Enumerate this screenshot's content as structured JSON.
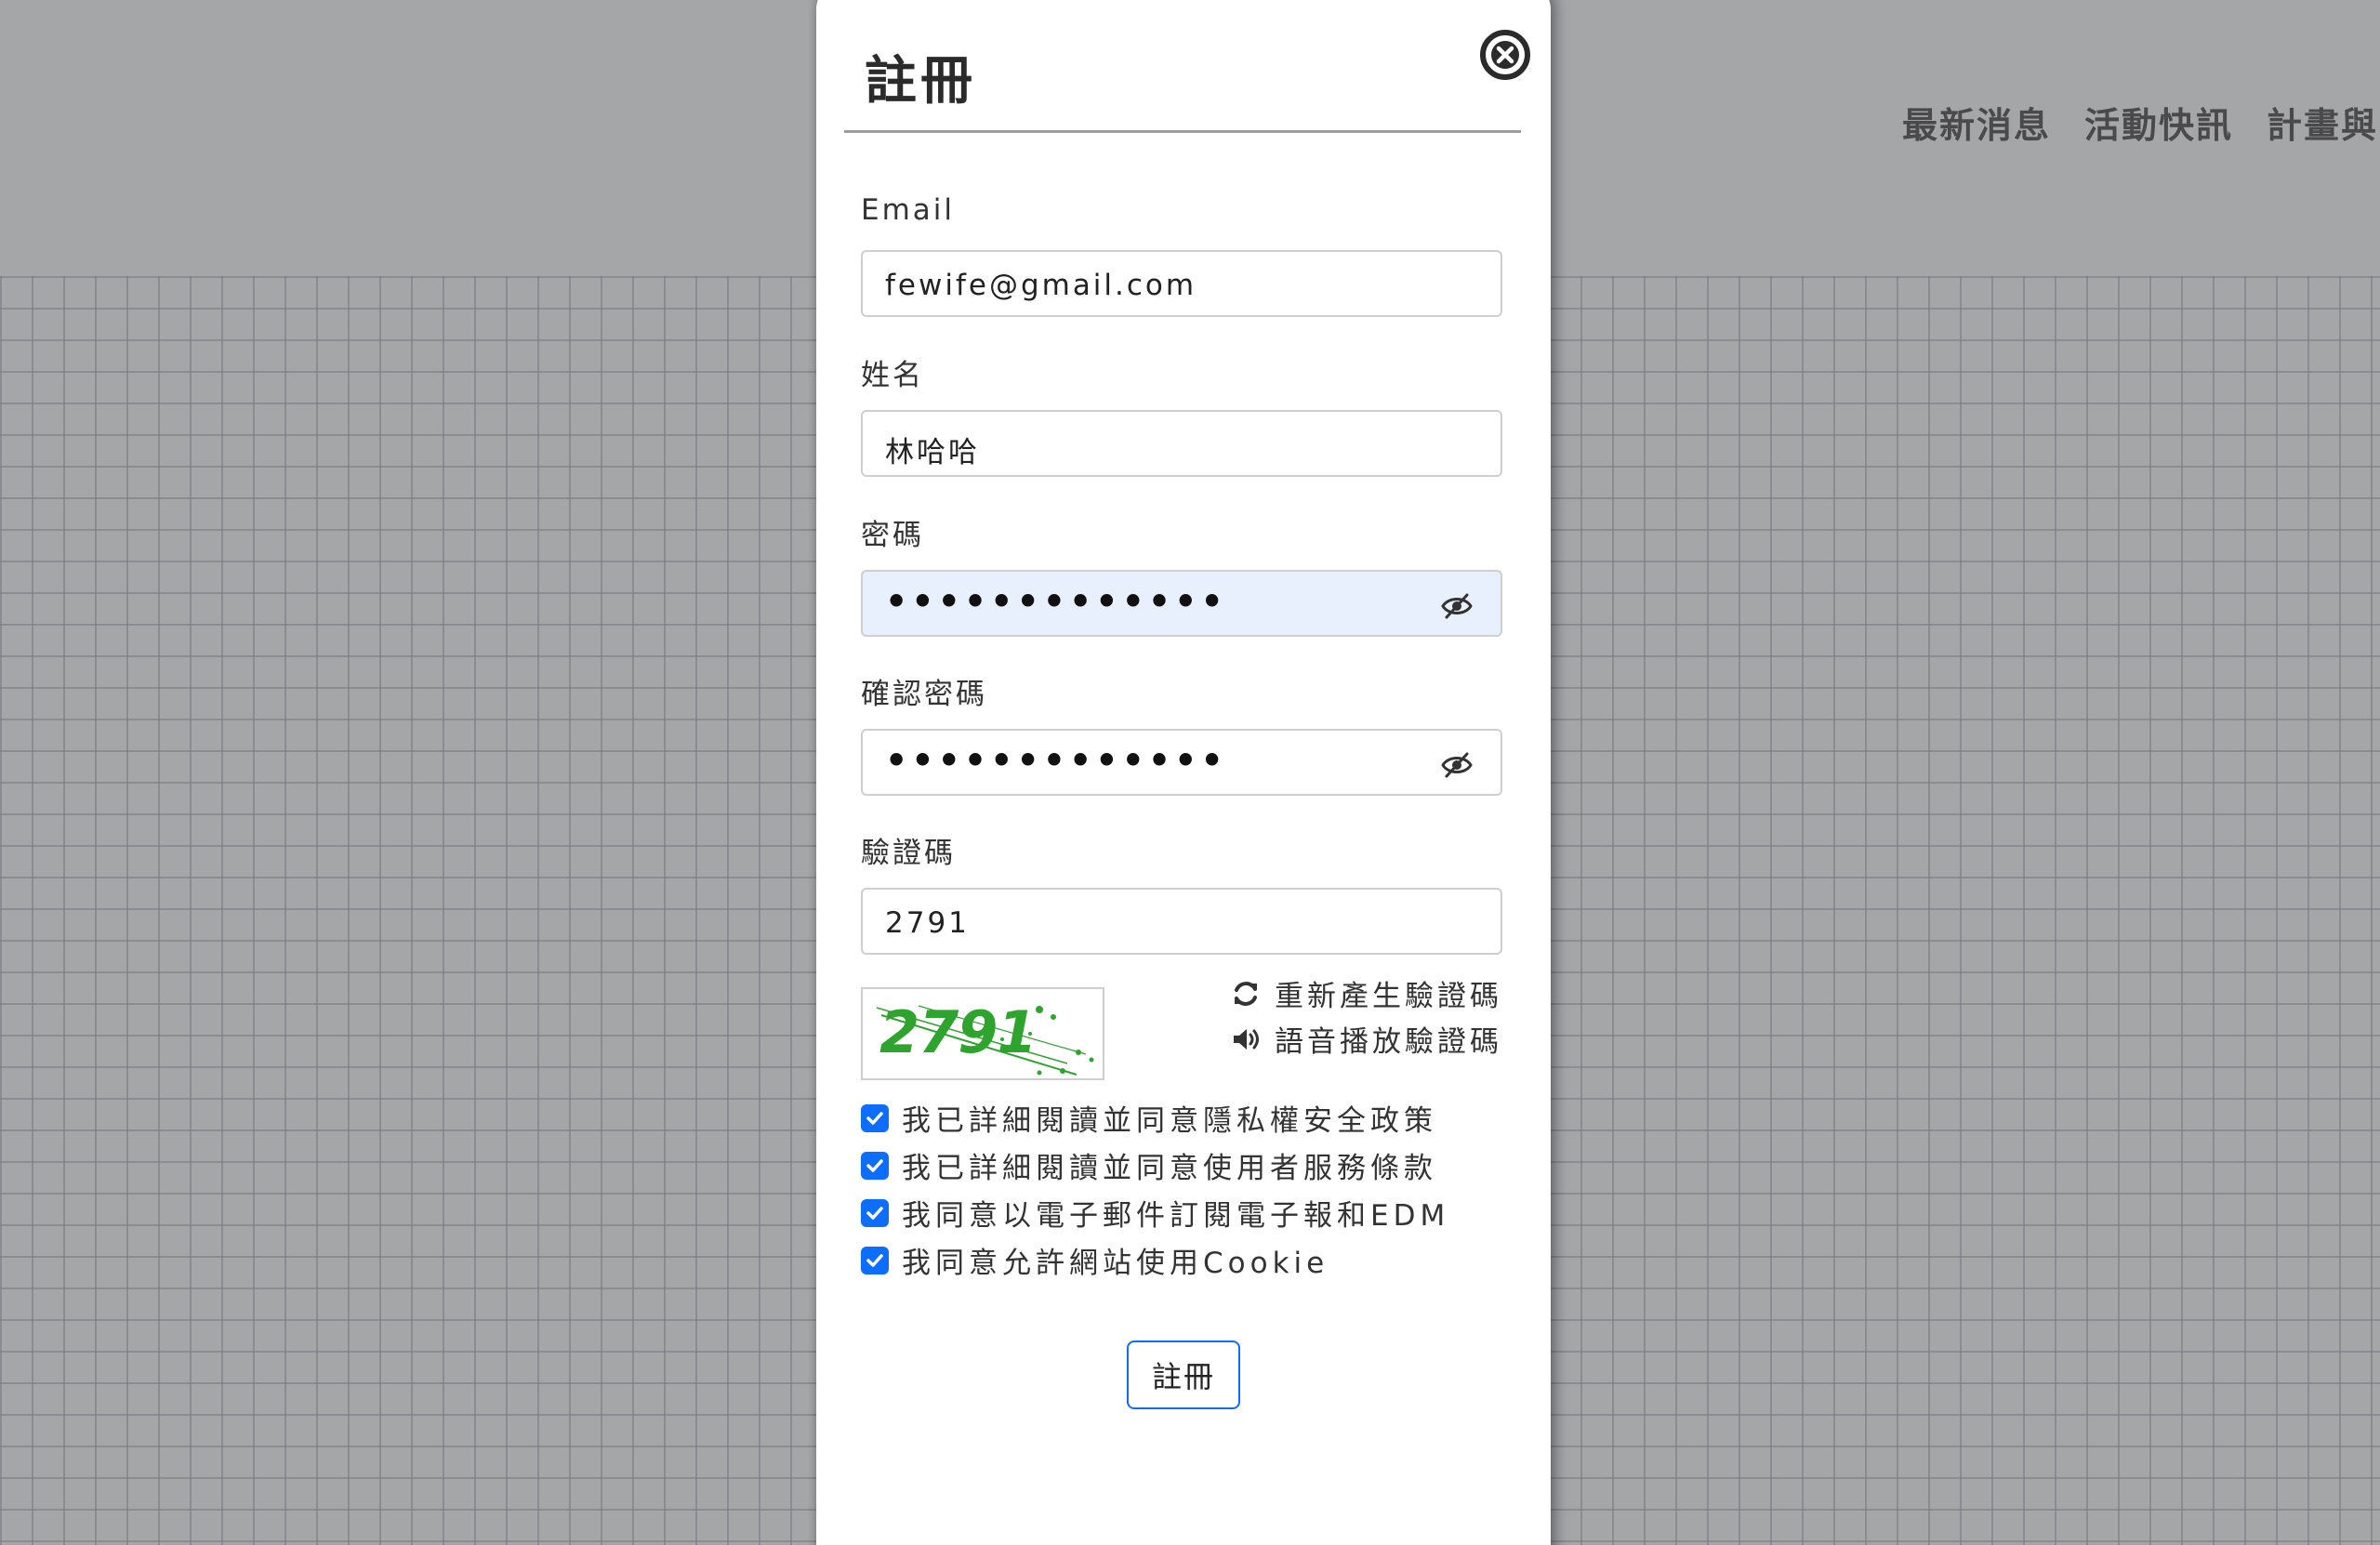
{
  "nav": {
    "items": [
      "最新消息",
      "活動快訊",
      "計畫與"
    ]
  },
  "modal": {
    "title": "註冊",
    "close_icon": "close-circle-icon",
    "fields": {
      "email": {
        "label": "Email",
        "value": "fewife@gmail.com"
      },
      "name": {
        "label": "姓名",
        "value": "林哈哈"
      },
      "password": {
        "label": "密碼",
        "value": "•••••••••••••"
      },
      "confirm_password": {
        "label": "確認密碼",
        "value": "•••••••••••••"
      },
      "captcha_input": {
        "label": "驗證碼",
        "value": "2791"
      }
    },
    "captcha": {
      "image_text": "2791",
      "refresh_label": "重新產生驗證碼",
      "refresh_icon": "refresh-icon",
      "audio_label": "語音播放驗證碼",
      "audio_icon": "speaker-icon"
    },
    "agreements": [
      {
        "label": "我已詳細閱讀並同意隱私權安全政策",
        "checked": true
      },
      {
        "label": "我已詳細閱讀並同意使用者服務條款",
        "checked": true
      },
      {
        "label": "我同意以電子郵件訂閱電子報和EDM",
        "checked": true
      },
      {
        "label": "我同意允許網站使用Cookie",
        "checked": true
      }
    ],
    "submit_label": "註冊"
  },
  "colors": {
    "accent": "#0d6efd",
    "captcha_green": "#2ea42e",
    "overlay": "#a5a6a8",
    "autofill": "#e8f0fe"
  }
}
